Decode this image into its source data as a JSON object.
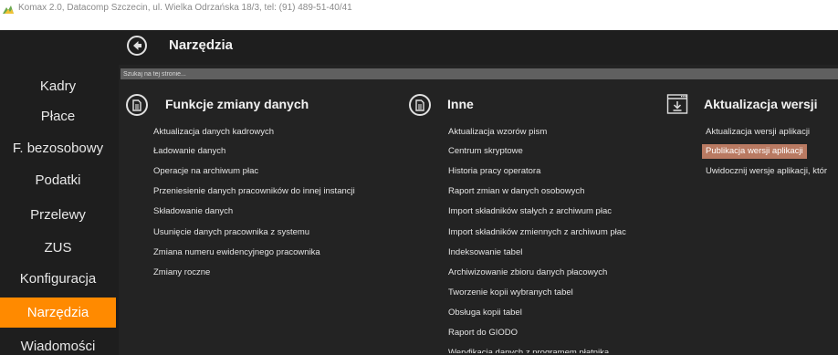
{
  "window": {
    "title": "Komax 2.0, Datacomp Szczecin, ul. Wielka Odrzańska 18/3, tel: (91) 489-51-40/41"
  },
  "header": {
    "title": "Narzędzia"
  },
  "sidebar": {
    "items": [
      {
        "label": "Kadry"
      },
      {
        "label": "Płace"
      },
      {
        "label": "F. bezosobowy"
      },
      {
        "label": "Podatki"
      },
      {
        "label": "Przelewy"
      },
      {
        "label": "ZUS"
      },
      {
        "label": "Konfiguracja"
      },
      {
        "label": "Narzędzia",
        "active": true
      },
      {
        "label": "Wiadomości"
      }
    ]
  },
  "search": {
    "placeholder": "Szukaj na tej stronie..."
  },
  "sections": [
    {
      "title": "Funkcje zmiany danych",
      "icon": "document-icon",
      "items": [
        "Aktualizacja danych kadrowych",
        "Ładowanie danych",
        "Operacje na archiwum płac",
        "Przeniesienie danych pracowników do innej instancji",
        "Składowanie danych",
        "Usunięcie danych pracownika z systemu",
        "Zmiana numeru ewidencyjnego pracownika",
        "Zmiany roczne"
      ]
    },
    {
      "title": "Inne",
      "icon": "document-icon",
      "items": [
        "Aktualizacja wzorów pism",
        "Centrum skryptowe",
        "Historia pracy operatora",
        "Raport zmian w danych osobowych",
        "Import składników stałych z archiwum płac",
        "Import składników zmiennych z archiwum płac",
        "Indeksowanie tabel",
        "Archiwizowanie zbioru danych płacowych",
        "Tworzenie kopii wybranych tabel",
        "Obsługa kopii tabel",
        "Raport do GIODO",
        "Weryfikacja danych z programem płatnika"
      ]
    },
    {
      "title": "Aktualizacja wersji",
      "icon": "download-window-icon",
      "items": [
        "Aktualizacja wersji aplikacji",
        "Publikacja wersji aplikacji",
        "Uwidocznij wersje aplikacji, któr"
      ],
      "highlighted_index": 1
    }
  ],
  "colors": {
    "background": "#1e1e1e",
    "active": "#ff8a00",
    "highlight": "#b97a62",
    "search_bar": "#606060"
  }
}
